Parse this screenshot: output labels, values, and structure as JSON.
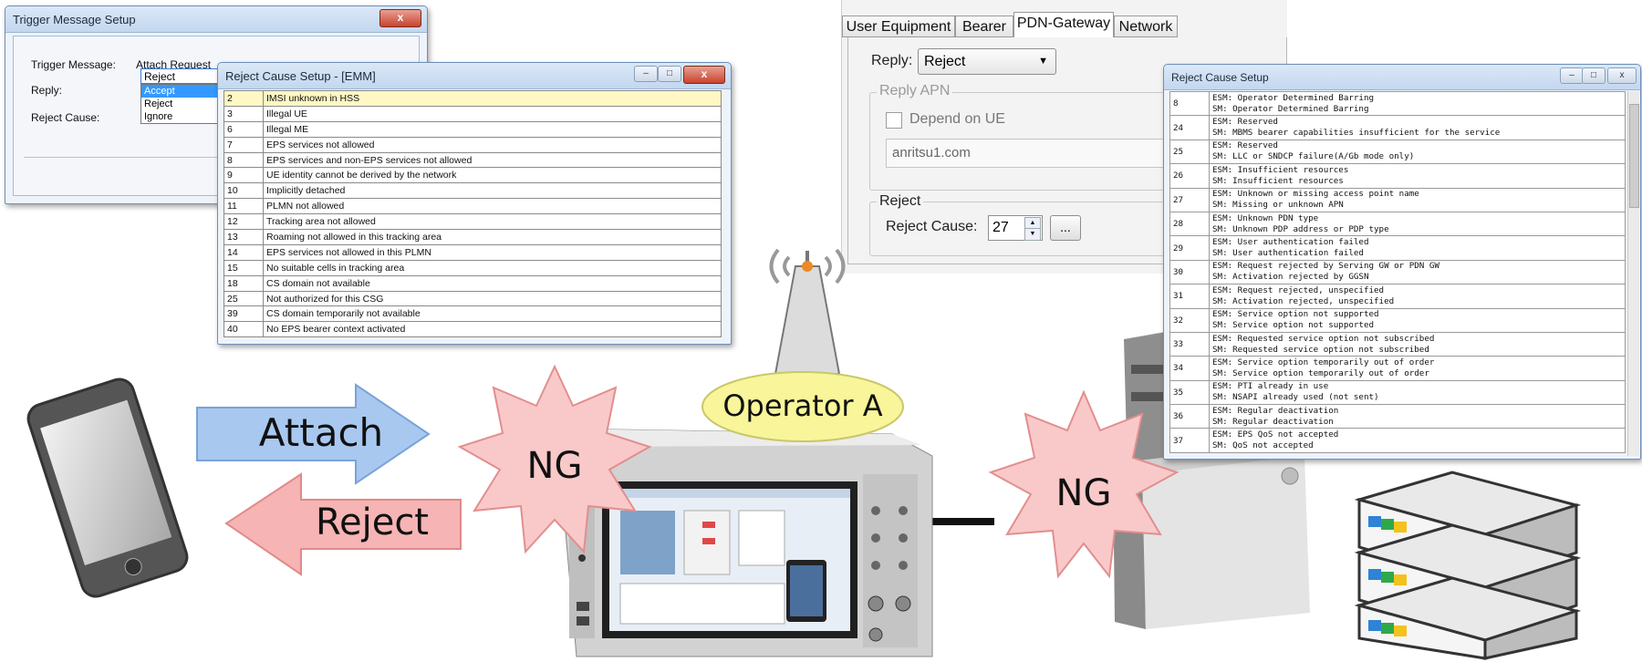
{
  "trigger_window": {
    "title": "Trigger Message Setup",
    "close": "x",
    "trigger_message_label": "Trigger Message:",
    "trigger_message_value": "Attach Request",
    "reply_label": "Reply:",
    "reply_value": "Reject",
    "reply_options": [
      "Accept",
      "Reject",
      "Ignore"
    ],
    "reject_cause_label": "Reject Cause:"
  },
  "emm_window": {
    "title": "Reject Cause Setup - [EMM]",
    "rows": [
      {
        "code": "2",
        "text": "IMSI unknown in HSS"
      },
      {
        "code": "3",
        "text": "Illegal UE"
      },
      {
        "code": "6",
        "text": "Illegal ME"
      },
      {
        "code": "7",
        "text": "EPS services not allowed"
      },
      {
        "code": "8",
        "text": "EPS services and non-EPS services not allowed"
      },
      {
        "code": "9",
        "text": "UE identity cannot be derived by the network"
      },
      {
        "code": "10",
        "text": "Implicitly detached"
      },
      {
        "code": "11",
        "text": "PLMN not allowed"
      },
      {
        "code": "12",
        "text": "Tracking area not allowed"
      },
      {
        "code": "13",
        "text": "Roaming not allowed in this tracking area"
      },
      {
        "code": "14",
        "text": "EPS services not allowed in this PLMN"
      },
      {
        "code": "15",
        "text": "No suitable cells in tracking area"
      },
      {
        "code": "18",
        "text": "CS domain not available"
      },
      {
        "code": "25",
        "text": "Not authorized for this CSG"
      },
      {
        "code": "39",
        "text": "CS domain temporarily not available"
      },
      {
        "code": "40",
        "text": "No EPS bearer context activated"
      }
    ]
  },
  "pdn_panel": {
    "tabs": [
      "User Equipment",
      "Bearer",
      "PDN-Gateway",
      "Network"
    ],
    "active_tab": "PDN-Gateway",
    "reply_label": "Reply:",
    "reply_value": "Reject",
    "reply_apn_group": "Reply APN",
    "depend_on_ue_label": "Depend on UE",
    "apn_value": "anritsu1.com",
    "reject_group": "Reject",
    "reject_cause_label": "Reject Cause:",
    "reject_cause_value": "27",
    "browse_label": "..."
  },
  "esm_window": {
    "title": "Reject Cause Setup",
    "rows": [
      {
        "code": "8",
        "esm": "ESM: Operator Determined Barring",
        "sm": "SM:  Operator Determined Barring"
      },
      {
        "code": "24",
        "esm": "ESM: Reserved",
        "sm": "SM:  MBMS bearer capabilities insufficient for the service"
      },
      {
        "code": "25",
        "esm": "ESM: Reserved",
        "sm": "SM:  LLC or SNDCP failure(A/Gb mode only)"
      },
      {
        "code": "26",
        "esm": "ESM: Insufficient resources",
        "sm": "SM:  Insufficient resources"
      },
      {
        "code": "27",
        "esm": "ESM: Unknown or missing access point name",
        "sm": "SM:  Missing or unknown APN"
      },
      {
        "code": "28",
        "esm": "ESM: Unknown PDN type",
        "sm": "SM:  Unknown PDP address or PDP type"
      },
      {
        "code": "29",
        "esm": "ESM: User authentication failed",
        "sm": "SM:  User authentication failed"
      },
      {
        "code": "30",
        "esm": "ESM: Request rejected by Serving GW or PDN GW",
        "sm": "SM:  Activation rejected by GGSN"
      },
      {
        "code": "31",
        "esm": "ESM: Request rejected, unspecified",
        "sm": "SM:  Activation rejected, unspecified"
      },
      {
        "code": "32",
        "esm": "ESM: Service option not supported",
        "sm": "SM:  Service option not supported"
      },
      {
        "code": "33",
        "esm": "ESM: Requested service option not subscribed",
        "sm": "SM:  Requested service option not subscribed"
      },
      {
        "code": "34",
        "esm": "ESM: Service option temporarily out of order",
        "sm": "SM:  Service option temporarily out of order"
      },
      {
        "code": "35",
        "esm": "ESM: PTI already in use",
        "sm": "SM:  NSAPI already used (not sent)"
      },
      {
        "code": "36",
        "esm": "ESM: Regular deactivation",
        "sm": "SM:  Regular deactivation"
      },
      {
        "code": "37",
        "esm": "ESM: EPS QoS not accepted",
        "sm": "SM:  QoS not accepted"
      }
    ]
  },
  "diagram": {
    "attach_label": "Attach",
    "reject_label": "Reject",
    "ng_label_left": "NG",
    "ng_label_right": "NG",
    "operator_label": "Operator A"
  },
  "colors": {
    "attach_arrow": "#a9c8f0",
    "reject_arrow": "#f6b4b4",
    "starburst": "#f9c9c9",
    "operator_bubble": "#f8f59a"
  }
}
